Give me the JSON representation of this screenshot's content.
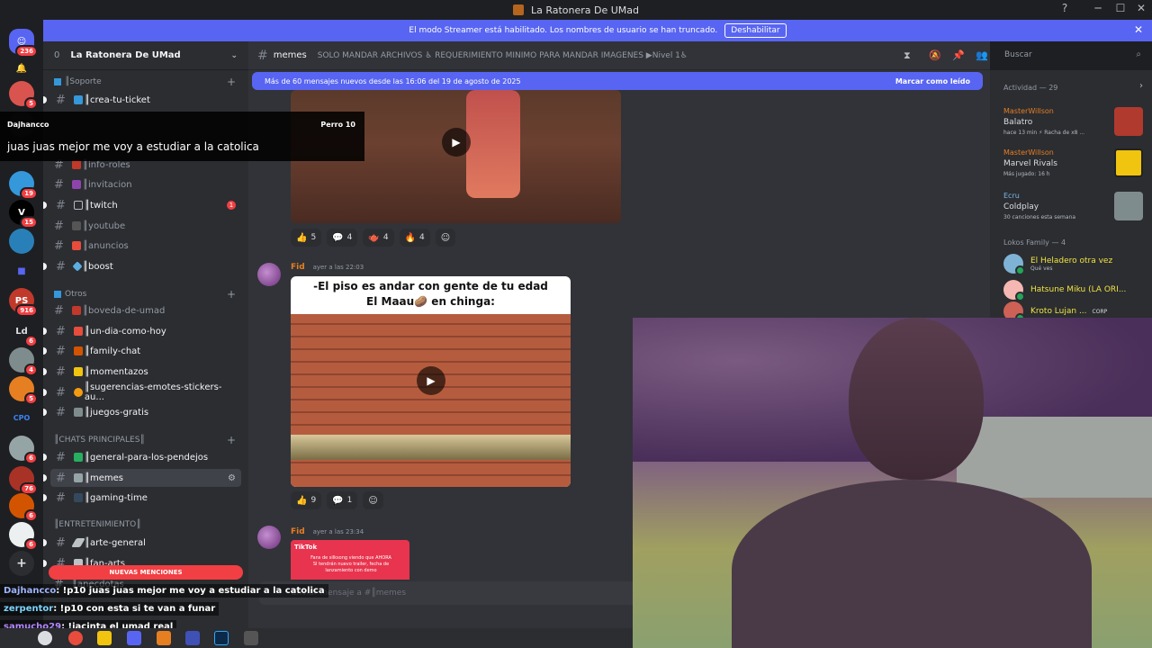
{
  "window": {
    "title": "La Ratonera De UMad",
    "help": "?",
    "minimize": "─",
    "maximize": "☐",
    "close": "✕"
  },
  "rail": {
    "dm_badge": "236",
    "servers": [
      {
        "abbr": "",
        "badge": "5"
      },
      {
        "abbr": "",
        "badge": ""
      },
      {
        "abbr": "",
        "badge": "19"
      },
      {
        "abbr": "V",
        "badge": "15"
      },
      {
        "abbr": "",
        "badge": ""
      },
      {
        "abbr": "",
        "badge": ""
      },
      {
        "abbr": "PS",
        "badge": "916"
      },
      {
        "abbr": "Ld",
        "badge": "6"
      },
      {
        "abbr": "",
        "badge": "4"
      },
      {
        "abbr": "",
        "badge": "5"
      },
      {
        "abbr": "CPO",
        "badge": ""
      },
      {
        "abbr": "",
        "badge": "6"
      },
      {
        "abbr": "",
        "badge": "76"
      },
      {
        "abbr": "",
        "badge": "6"
      },
      {
        "abbr": "",
        "badge": "6"
      }
    ],
    "add_label": "+"
  },
  "banner": {
    "text": "El modo Streamer está habilitado. Los nombres de usuario se han truncado.",
    "button": "Deshabilitar",
    "close": "✕"
  },
  "sidebar": {
    "server_name": "La Ratonera De UMad",
    "zero": "0",
    "chevron": "⌄",
    "categories": {
      "soporte": "║Soporte",
      "otros": "Otros",
      "chats": "║CHATS PRINCIPALES║",
      "entretenimiento": "║ENTRETENIMIENTO║"
    },
    "channels": {
      "crea_tu_ticket": "║crea-tu-ticket",
      "info_roles": "║info-roles",
      "invitacion": "║invitacion",
      "twitch": "║twitch",
      "twitch_count": "1",
      "youtube": "║youtube",
      "anuncios": "║anuncios",
      "boost": "║boost",
      "boveda": "║boveda-de-umad",
      "un_dia": "║un-dia-como-hoy",
      "family_chat": "║family-chat",
      "momentazos": "║momentazos",
      "sugerencias": "║sugerencias-emotes-stickers-au...",
      "juegos_gratis": "║juegos-gratis",
      "general": "║general-para-los-pendejos",
      "memes": "║memes",
      "gaming_time": "║gaming-time",
      "arte_general": "║arte-general",
      "fan_arts": "║fan-arts",
      "anecdotas": "║anecdotas"
    },
    "mentions": "NUEVAS MENCIONES"
  },
  "notification": {
    "user": "Dajhancco",
    "from": "Perro 10",
    "message": "juas juas mejor me voy a estudiar a la catolica"
  },
  "chat": {
    "channel": "memes",
    "topic": "SOLO MANDAR ARCHIVOS ♿ REQUERIMIENTO MINIMO PARA MANDAR IMAGENES ▶Nivel 1♿",
    "new_messages": "Más de 60 mensajes nuevos desde las 16:06 del 19 de agosto de 2025",
    "mark_read": "Marcar como leído",
    "search_placeholder": "Buscar",
    "reactions1": [
      {
        "emoji": "👍",
        "count": "5"
      },
      {
        "emoji": "💬",
        "count": "4"
      },
      {
        "emoji": "🫖",
        "count": "4"
      },
      {
        "emoji": "🔥",
        "count": "4"
      }
    ],
    "msg2": {
      "author": "Fid",
      "time": "ayer a las 22:03",
      "caption_line1": "-El piso es andar con gente de tu edad",
      "caption_line2": "El Maau🥔 en chinga:"
    },
    "reactions2": [
      {
        "emoji": "👍",
        "count": "9"
      },
      {
        "emoji": "💬",
        "count": "1"
      }
    ],
    "msg3": {
      "author": "Fid",
      "time": "ayer a las 23:34",
      "tiktok": "TikTok",
      "tiktok_text": "Fans de silksong viendo que AHORA SI tendrán nuevo trailer, fecha de lanzamiento con demo"
    },
    "composer_placeholder": "Enviar mensaje a #║memes"
  },
  "members": {
    "activity_title": "Actividad — 29",
    "activities": [
      {
        "name": "MasterWillson",
        "game": "Balatro",
        "detail": "hace 13 min  ⚡ Racha de x8 ..."
      },
      {
        "name": "MasterWillson",
        "game": "Marvel Rivals",
        "detail": "Más jugado: 16 h"
      },
      {
        "name": "Ecru",
        "game": "Coldplay",
        "detail": "30 canciones esta semana"
      }
    ],
    "family_title": "Lokos Family — 4",
    "family": [
      {
        "name": "El Heladero otra vez",
        "status": "Qué ves"
      },
      {
        "name": "Hatsune Miku (LA ORI...",
        "status": ""
      },
      {
        "name": "Kroto Lujan ...",
        "status": "",
        "tag": "CORP"
      }
    ]
  },
  "stream_chat": [
    {
      "user": "Dajhancco",
      "text": ": !p10 juas juas mejor me voy a estudiar a la catolica"
    },
    {
      "user": "zerpentor",
      "text": ": !p10 con esta si te van a funar"
    },
    {
      "user": "samucho29",
      "text": ": !jacinta el umad real"
    }
  ],
  "colors": {
    "blurple": "#5865f2",
    "red": "#f23f43",
    "bg": "#313338",
    "sidebar": "#2b2d31"
  }
}
